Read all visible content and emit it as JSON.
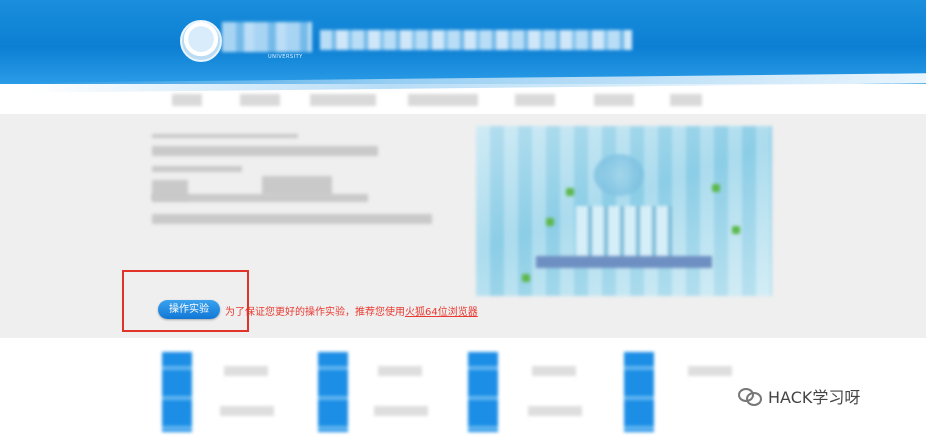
{
  "header": {
    "logo_subtitle": "UNIVERSITY"
  },
  "main": {
    "operate_button_label": "操作实验",
    "notice_prefix": "为了保证您更好的操作实验，推荐您使用",
    "notice_link": "火狐64位浏览器"
  },
  "watermark": {
    "text": "HACK学习呀",
    "icon": "wechat-icon"
  },
  "colors": {
    "header_blue": "#0c7fd3",
    "button_blue": "#1177d6",
    "notice_red": "#e83a30",
    "highlight_red": "#e0342a"
  }
}
